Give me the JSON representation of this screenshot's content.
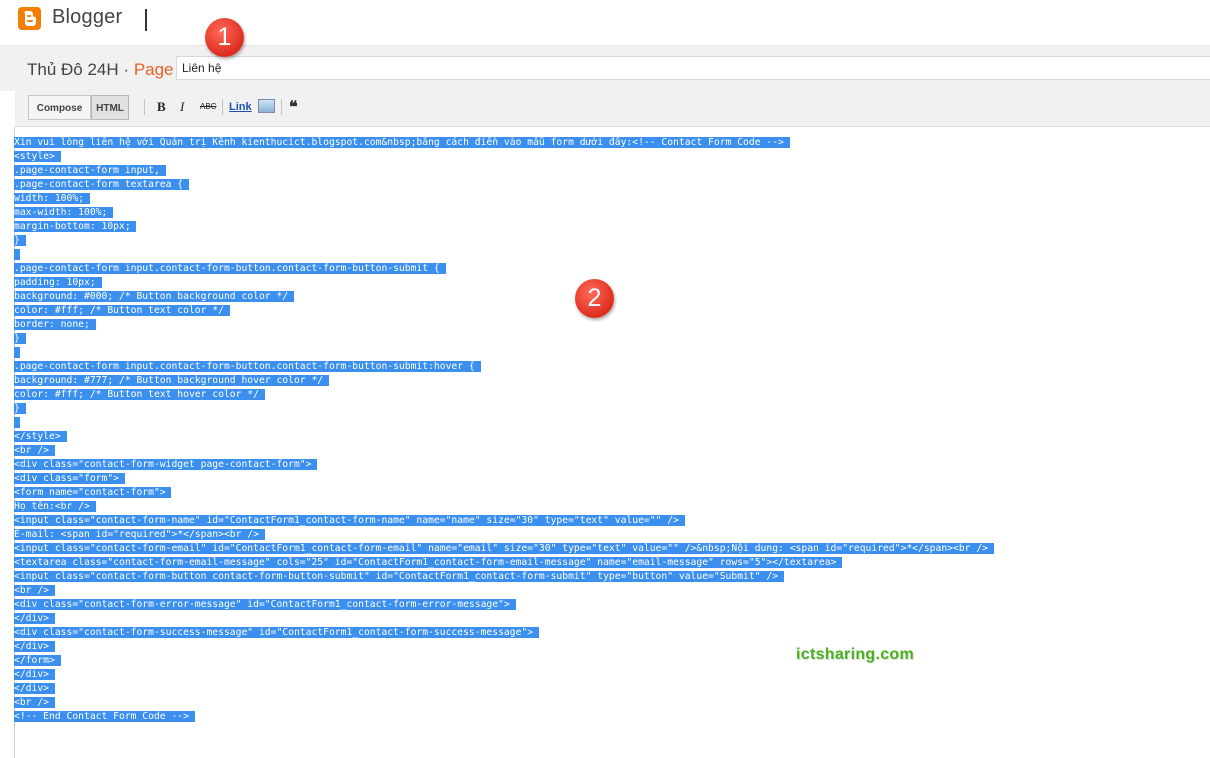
{
  "header": {
    "brand": "Blogger",
    "logo_icon": "blogger-logo-icon"
  },
  "title_bar": {
    "blog_name": "Thủ Đô 24H",
    "separator": "·",
    "page_label": "Page",
    "page_title_value": "Liên hệ"
  },
  "toolbar": {
    "compose_label": "Compose",
    "html_label": "HTML",
    "bold_label": "B",
    "italic_label": "I",
    "strike_label": "ABC",
    "link_label": "Link",
    "image_icon": "insert-image-icon",
    "quote_label": "❝",
    "active_mode": "HTML"
  },
  "annotations": {
    "badge_1": "1",
    "badge_2": "2",
    "watermark": "ictsharing.com"
  },
  "colors": {
    "selection": "#3b8fee",
    "page_accent": "#e8632b",
    "badge_red": "#dd2d1e",
    "watermark_green": "#49b11c",
    "logo_orange": "#f57d00"
  },
  "code_lines": [
    "Xin vui lòng liên hệ với Quản trị Kênh kienthucict.blogspot.com&nbsp;bằng cách điền vào mẫu form dưới đây:<!-- Contact Form Code -->",
    "<style>",
    ".page-contact-form input,",
    ".page-contact-form textarea {",
    "width: 100%;",
    "max-width: 100%;",
    "margin-bottom: 10px;",
    "}",
    "",
    ".page-contact-form input.contact-form-button.contact-form-button-submit {",
    "padding: 10px;",
    "background: #000; /* Button background color */",
    "color: #fff; /* Button text color */",
    "border: none;",
    "}",
    "",
    ".page-contact-form input.contact-form-button.contact-form-button-submit:hover {",
    "background: #777; /* Button background hover color */",
    "color: #fff; /* Button text hover color */",
    "}",
    "",
    "</style>",
    "<br />",
    "<div class=\"contact-form-widget page-contact-form\">",
    "<div class=\"form\">",
    "<form name=\"contact-form\">",
    "Họ tên:<br />",
    "<input class=\"contact-form-name\" id=\"ContactForm1_contact-form-name\" name=\"name\" size=\"30\" type=\"text\" value=\"\" />",
    "E-mail: <span id=\"required\">*</span><br />",
    "<input class=\"contact-form-email\" id=\"ContactForm1_contact-form-email\" name=\"email\" size=\"30\" type=\"text\" value=\"\" />&nbsp;Nội dung: <span id=\"required\">*</span><br />",
    "<textarea class=\"contact-form-email-message\" cols=\"25\" id=\"ContactForm1_contact-form-email-message\" name=\"email-message\" rows=\"5\"></textarea>",
    "<input class=\"contact-form-button contact-form-button-submit\" id=\"ContactForm1_contact-form-submit\" type=\"button\" value=\"Submit\" />",
    "<br />",
    "<div class=\"contact-form-error-message\" id=\"ContactForm1_contact-form-error-message\">",
    "</div>",
    "<div class=\"contact-form-success-message\" id=\"ContactForm1_contact-form-success-message\">",
    "</div>",
    "</form>",
    "</div>",
    "</div>",
    "<br />",
    "<!-- End Contact Form Code -->"
  ]
}
